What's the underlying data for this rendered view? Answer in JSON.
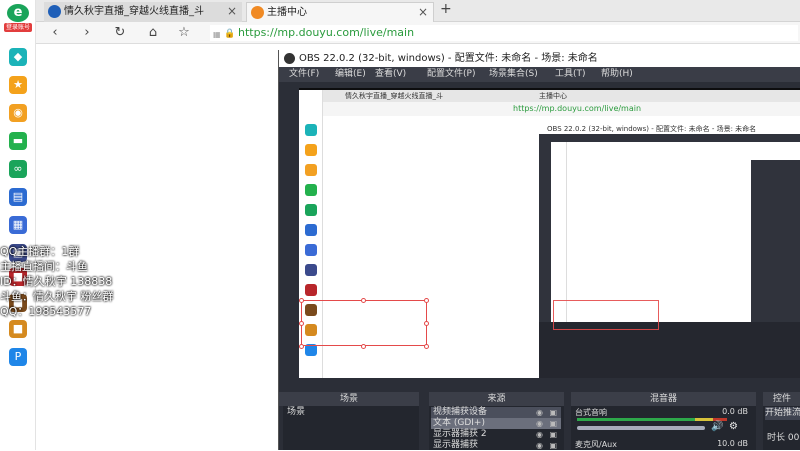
{
  "rail": {
    "logo_letter": "e",
    "logo_label": "登录账号",
    "items": [
      {
        "icon": "diamond-icon",
        "color": "#1bb3b8"
      },
      {
        "icon": "star-icon",
        "color": "#f4a21b"
      },
      {
        "icon": "weibo-icon",
        "color": "#f2a022"
      },
      {
        "icon": "screen-icon",
        "color": "#23b14d"
      },
      {
        "icon": "link-icon",
        "color": "#1aa45a"
      },
      {
        "icon": "game-icon",
        "color": "#2c6bd1"
      },
      {
        "icon": "document-icon",
        "color": "#3a6bd6"
      },
      {
        "icon": "app-icon",
        "color": "#3b4a8c"
      },
      {
        "icon": "game-tile-icon",
        "color": "#b8262b"
      },
      {
        "icon": "game-tile-icon-2",
        "color": "#7a4a1c"
      },
      {
        "icon": "game-tile-icon-3",
        "color": "#d58a1f"
      },
      {
        "icon": "p-icon",
        "color": "#1f86e8"
      }
    ]
  },
  "tabs": [
    {
      "title": "情久秋宇直播_穿越火线直播_斗",
      "active": false
    },
    {
      "title": "主播中心",
      "active": true
    }
  ],
  "toolbar": {
    "url": "https://mp.douyu.com/live/main",
    "back": "‹",
    "forward": "›",
    "reload": "↻",
    "home": "⌂",
    "bookmark": "☆"
  },
  "obs": {
    "title": "OBS 22.0.2 (32-bit, windows) - 配置文件: 未命名 - 场景: 未命名",
    "menu": [
      "文件(F)",
      "编辑(E)",
      "查看(V)",
      "配置文件(P)",
      "场景集合(S)",
      "工具(T)",
      "帮助(H)"
    ],
    "scenes_header": "场景",
    "sources_header": "来源",
    "mixer_header": "混音器",
    "controls_header": "控件",
    "scenes": [
      "场景"
    ],
    "sources": [
      "视频捕获设备",
      "文本 (GDI+)",
      "显示器捕获 2",
      "显示器捕获"
    ],
    "mixer_channel": "台式音响",
    "mixer_value": "0.0 dB",
    "mixer_channel_2": "麦克风/Aux",
    "mixer_value_2": "10.0 dB",
    "controls": [
      "开始推流",
      "时长 00"
    ]
  },
  "overlay_lines": [
    "QQ主播群：1群",
    "主播直播间：斗鱼",
    "ID：情久秋宇 138838",
    "斗鱼：情久秋宇 粉丝群",
    "QQ：198543577"
  ],
  "colors": {
    "obs_bg": "#2b2e37",
    "selection_red": "#e44a4a",
    "url_green": "#2a9b3d"
  }
}
